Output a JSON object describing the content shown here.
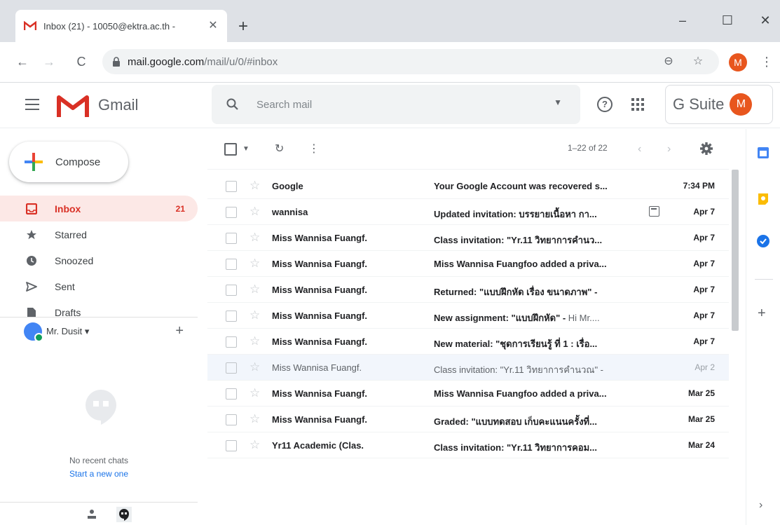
{
  "browser": {
    "tab_title": "Inbox (21) - 10050@ektra.ac.th -",
    "tab_close": "✕",
    "new_tab": "+",
    "url_host": "mail.google.com",
    "url_path": "/mail/u/0/#inbox",
    "profile_initial": "M",
    "window_controls": {
      "minimize": "–",
      "maximize": "☐",
      "close": "✕"
    }
  },
  "header": {
    "product_name": "Gmail",
    "search_placeholder": "Search mail",
    "suite_name": "G Suite",
    "account_initial": "M"
  },
  "sidebar": {
    "compose_label": "Compose",
    "items": [
      {
        "label": "Inbox",
        "count": "21",
        "active": true,
        "icon": "inbox-icon"
      },
      {
        "label": "Starred",
        "count": "",
        "active": false,
        "icon": "star-icon"
      },
      {
        "label": "Snoozed",
        "count": "",
        "active": false,
        "icon": "clock-icon"
      },
      {
        "label": "Sent",
        "count": "",
        "active": false,
        "icon": "send-icon"
      },
      {
        "label": "Drafts",
        "count": "",
        "active": false,
        "icon": "draft-icon"
      }
    ],
    "hangouts_user": "Mr. Dusit ▾",
    "no_chats": "No recent chats",
    "start_chat": "Start a new one"
  },
  "toolbar": {
    "pagination": "1–22 of 22"
  },
  "emails": [
    {
      "sender": "Google",
      "subject": "Your Google Account was recovered s...",
      "snippet": "",
      "date": "7:34 PM",
      "read": false,
      "calendar": false
    },
    {
      "sender": "wannisa",
      "subject": "Updated invitation: บรรยายเนื้อหา กา...",
      "snippet": "",
      "date": "Apr 7",
      "read": false,
      "calendar": true
    },
    {
      "sender": "Miss Wannisa Fuangf.",
      "subject": "Class invitation: \"Yr.11 วิทยาการคำนว...",
      "snippet": "",
      "date": "Apr 7",
      "read": false,
      "calendar": false
    },
    {
      "sender": "Miss Wannisa Fuangf.",
      "subject": "Miss Wannisa Fuangfoo added a priva...",
      "snippet": "",
      "date": "Apr 7",
      "read": false,
      "calendar": false
    },
    {
      "sender": "Miss Wannisa Fuangf.",
      "subject": "Returned: \"แบบฝึกหัด เรื่อง ขนาดภาพ\" -",
      "snippet": "",
      "date": "Apr 7",
      "read": false,
      "calendar": false
    },
    {
      "sender": "Miss Wannisa Fuangf.",
      "subject": "New assignment: \"แบบฝึกหัด\" - ",
      "snippet": "Hi Mr....",
      "date": "Apr 7",
      "read": false,
      "calendar": false
    },
    {
      "sender": "Miss Wannisa Fuangf.",
      "subject": "New material: \"ชุดการเรียนรู้ ที่ 1 : เรื่อ...",
      "snippet": "",
      "date": "Apr 7",
      "read": false,
      "calendar": false
    },
    {
      "sender": "Miss Wannisa Fuangf.",
      "subject": "Class invitation: \"Yr.11 วิทยาการคำนวณ\" -",
      "snippet": "",
      "date": "Apr 2",
      "read": true,
      "calendar": false
    },
    {
      "sender": "Miss Wannisa Fuangf.",
      "subject": "Miss Wannisa Fuangfoo added a priva...",
      "snippet": "",
      "date": "Mar 25",
      "read": false,
      "calendar": false
    },
    {
      "sender": "Miss Wannisa Fuangf.",
      "subject": "Graded: \"แบบทดสอบ เก็บคะแนนครั้งที่...",
      "snippet": "",
      "date": "Mar 25",
      "read": false,
      "calendar": false
    },
    {
      "sender": "Yr11 Academic (Clas.",
      "subject": "Class invitation: \"Yr.11 วิทยาการคอม...",
      "snippet": "",
      "date": "Mar 24",
      "read": false,
      "calendar": false
    }
  ],
  "colors": {
    "gmail_red": "#d93025",
    "inbox_highlight": "#fce8e6",
    "link_blue": "#1a73e8",
    "avatar_orange": "#e8561e"
  }
}
